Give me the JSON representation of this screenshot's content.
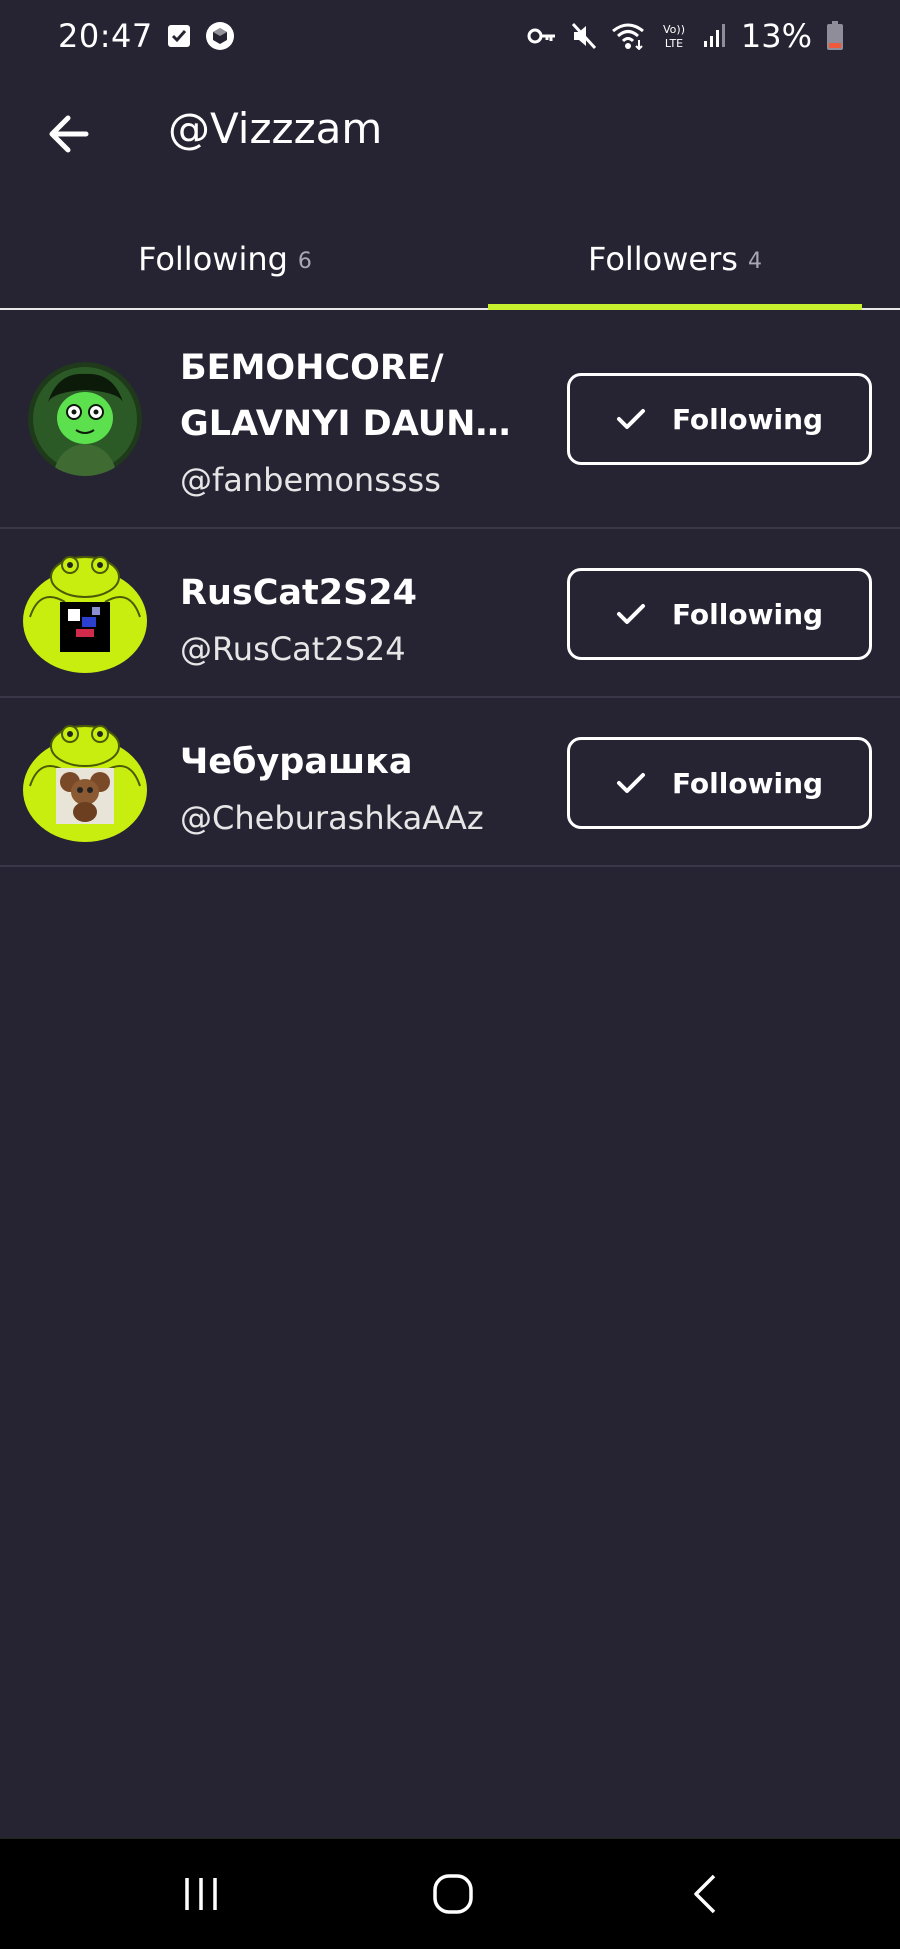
{
  "status_bar": {
    "time": "20:47",
    "battery_percent": "13%",
    "icons": [
      "checkbox-notification-icon",
      "cube-app-icon",
      "key-icon",
      "mute-icon",
      "wifi-icon",
      "volte-icon",
      "signal-icon",
      "battery-low-icon"
    ],
    "volte_text_top": "Vo))",
    "volte_text_bottom": "LTE"
  },
  "header": {
    "title": "@Vizzzam",
    "back_icon": "arrow-left-icon"
  },
  "tabs": [
    {
      "label": "Following",
      "count": "6",
      "active": false
    },
    {
      "label": "Followers",
      "count": "4",
      "active": true
    }
  ],
  "accent_color": "#c7f02d",
  "background_color": "#262433",
  "users": [
    {
      "display_name": "БЕМОНCORE/ GLAVNYI DAUN SERVERA",
      "handle": "@fanbemonssss",
      "button_label": "Following",
      "avatar_icon": "green-cartoon-avatar"
    },
    {
      "display_name": "RusCat2S24",
      "handle": "@RusCat2S24",
      "button_label": "Following",
      "avatar_icon": "lime-frog-avatar"
    },
    {
      "display_name": "Чебурашка",
      "handle": "@CheburashkaAAz",
      "button_label": "Following",
      "avatar_icon": "lime-frog-cheburashka-avatar"
    }
  ],
  "nav_bar": {
    "recents_icon": "recent-apps-icon",
    "home_icon": "home-icon",
    "back_icon": "nav-back-icon"
  }
}
